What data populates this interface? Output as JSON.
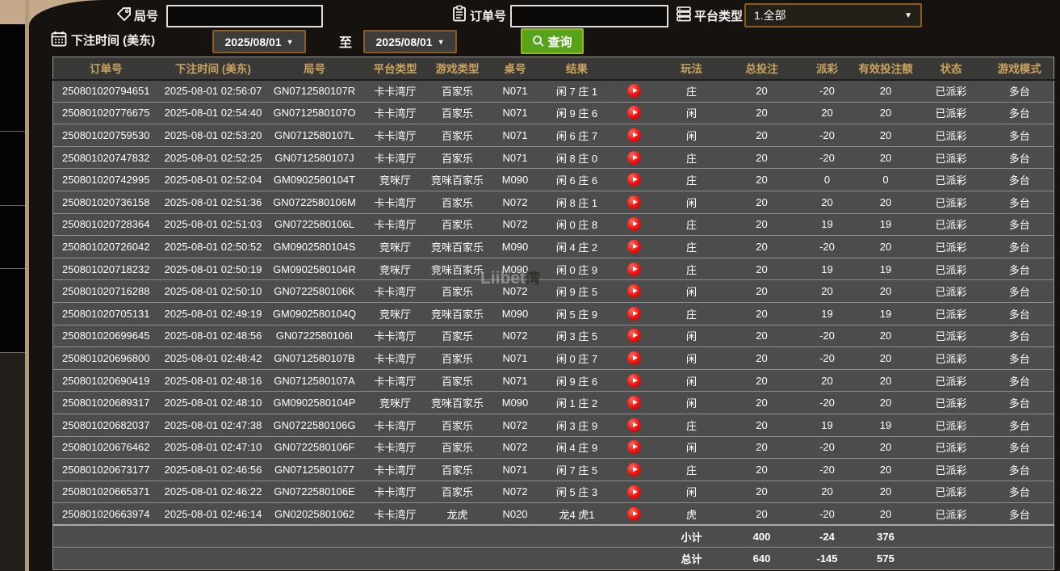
{
  "colors": {
    "win_red": "#c83c3c",
    "loss_green": "#32d232",
    "status_green": "#32d232",
    "total_yellow": "#e8e400",
    "header_gold": "#cba35e",
    "query_green": "#57a41a",
    "field_border_brown": "#8d5b1d"
  },
  "watermark": {
    "text": "Liibet",
    "suffix": "湾"
  },
  "form": {
    "round_label": "局号",
    "round_value": "",
    "order_label": "订单号",
    "order_value": "",
    "platform_label": "平台类型",
    "platform_value": "1.全部",
    "time_label": "下注时间 (美东)",
    "date_from": "2025/08/01",
    "to_label": "至",
    "date_to": "2025/08/01",
    "query_label": "查询",
    "dropdown_arrow": "▼"
  },
  "table": {
    "headers": [
      "订单号",
      "下注时间 (美东)",
      "局号",
      "平台类型",
      "游戏类型",
      "桌号",
      "结果",
      "",
      "玩法",
      "总投注",
      "派彩",
      "有效投注额",
      "状态",
      "游戏模式"
    ],
    "rows": [
      {
        "order": "250801020794651",
        "time": "2025-08-01 02:56:07",
        "round": "GN0712580107R",
        "platform": "卡卡湾厅",
        "game": "百家乐",
        "table_no": "N071",
        "result": "闲 7 庄 1",
        "bet": "庄",
        "total": "20",
        "payout": "-20",
        "payout_color": "green",
        "valid": "20",
        "status": "已派彩",
        "mode": "多台"
      },
      {
        "order": "250801020776675",
        "time": "2025-08-01 02:54:40",
        "round": "GN0712580107O",
        "platform": "卡卡湾厅",
        "game": "百家乐",
        "table_no": "N071",
        "result": "闲 9 庄 6",
        "bet": "闲",
        "total": "20",
        "payout": "20",
        "payout_color": "red",
        "valid": "20",
        "status": "已派彩",
        "mode": "多台"
      },
      {
        "order": "250801020759530",
        "time": "2025-08-01 02:53:20",
        "round": "GN0712580107L",
        "platform": "卡卡湾厅",
        "game": "百家乐",
        "table_no": "N071",
        "result": "闲 6 庄 7",
        "bet": "闲",
        "total": "20",
        "payout": "-20",
        "payout_color": "green",
        "valid": "20",
        "status": "已派彩",
        "mode": "多台"
      },
      {
        "order": "250801020747832",
        "time": "2025-08-01 02:52:25",
        "round": "GN0712580107J",
        "platform": "卡卡湾厅",
        "game": "百家乐",
        "table_no": "N071",
        "result": "闲 8 庄 0",
        "bet": "庄",
        "total": "20",
        "payout": "-20",
        "payout_color": "green",
        "valid": "20",
        "status": "已派彩",
        "mode": "多台"
      },
      {
        "order": "250801020742995",
        "time": "2025-08-01 02:52:04",
        "round": "GM0902580104T",
        "platform": "竞咪厅",
        "game": "竞咪百家乐",
        "table_no": "M090",
        "result": "闲 6 庄 6",
        "bet": "庄",
        "total": "20",
        "payout": "0",
        "payout_color": "white",
        "valid": "0",
        "status": "已派彩",
        "mode": "多台"
      },
      {
        "order": "250801020736158",
        "time": "2025-08-01 02:51:36",
        "round": "GN0722580106M",
        "platform": "卡卡湾厅",
        "game": "百家乐",
        "table_no": "N072",
        "result": "闲 8 庄 1",
        "bet": "闲",
        "total": "20",
        "payout": "20",
        "payout_color": "red",
        "valid": "20",
        "status": "已派彩",
        "mode": "多台"
      },
      {
        "order": "250801020728364",
        "time": "2025-08-01 02:51:03",
        "round": "GN0722580106L",
        "platform": "卡卡湾厅",
        "game": "百家乐",
        "table_no": "N072",
        "result": "闲 0 庄 8",
        "bet": "庄",
        "total": "20",
        "payout": "19",
        "payout_color": "red",
        "valid": "19",
        "status": "已派彩",
        "mode": "多台"
      },
      {
        "order": "250801020726042",
        "time": "2025-08-01 02:50:52",
        "round": "GM0902580104S",
        "platform": "竞咪厅",
        "game": "竞咪百家乐",
        "table_no": "M090",
        "result": "闲 4 庄 2",
        "bet": "庄",
        "total": "20",
        "payout": "-20",
        "payout_color": "green",
        "valid": "20",
        "status": "已派彩",
        "mode": "多台"
      },
      {
        "order": "250801020718232",
        "time": "2025-08-01 02:50:19",
        "round": "GM0902580104R",
        "platform": "竞咪厅",
        "game": "竞咪百家乐",
        "table_no": "M090",
        "result": "闲 0 庄 9",
        "bet": "庄",
        "total": "20",
        "payout": "19",
        "payout_color": "red",
        "valid": "19",
        "status": "已派彩",
        "mode": "多台"
      },
      {
        "order": "250801020716288",
        "time": "2025-08-01 02:50:10",
        "round": "GN0722580106K",
        "platform": "卡卡湾厅",
        "game": "百家乐",
        "table_no": "N072",
        "result": "闲 9 庄 5",
        "bet": "闲",
        "total": "20",
        "payout": "20",
        "payout_color": "red",
        "valid": "20",
        "status": "已派彩",
        "mode": "多台"
      },
      {
        "order": "250801020705131",
        "time": "2025-08-01 02:49:19",
        "round": "GM0902580104Q",
        "platform": "竞咪厅",
        "game": "竞咪百家乐",
        "table_no": "M090",
        "result": "闲 5 庄 9",
        "bet": "庄",
        "total": "20",
        "payout": "19",
        "payout_color": "red",
        "valid": "19",
        "status": "已派彩",
        "mode": "多台"
      },
      {
        "order": "250801020699645",
        "time": "2025-08-01 02:48:56",
        "round": "GN0722580106I",
        "platform": "卡卡湾厅",
        "game": "百家乐",
        "table_no": "N072",
        "result": "闲 3 庄 5",
        "bet": "闲",
        "total": "20",
        "payout": "-20",
        "payout_color": "green",
        "valid": "20",
        "status": "已派彩",
        "mode": "多台"
      },
      {
        "order": "250801020696800",
        "time": "2025-08-01 02:48:42",
        "round": "GN0712580107B",
        "platform": "卡卡湾厅",
        "game": "百家乐",
        "table_no": "N071",
        "result": "闲 0 庄 7",
        "bet": "闲",
        "total": "20",
        "payout": "-20",
        "payout_color": "green",
        "valid": "20",
        "status": "已派彩",
        "mode": "多台"
      },
      {
        "order": "250801020690419",
        "time": "2025-08-01 02:48:16",
        "round": "GN0712580107A",
        "platform": "卡卡湾厅",
        "game": "百家乐",
        "table_no": "N071",
        "result": "闲 9 庄 6",
        "bet": "闲",
        "total": "20",
        "payout": "20",
        "payout_color": "red",
        "valid": "20",
        "status": "已派彩",
        "mode": "多台"
      },
      {
        "order": "250801020689317",
        "time": "2025-08-01 02:48:10",
        "round": "GM0902580104P",
        "platform": "竞咪厅",
        "game": "竞咪百家乐",
        "table_no": "M090",
        "result": "闲 1 庄 2",
        "bet": "闲",
        "total": "20",
        "payout": "-20",
        "payout_color": "green",
        "valid": "20",
        "status": "已派彩",
        "mode": "多台"
      },
      {
        "order": "250801020682037",
        "time": "2025-08-01 02:47:38",
        "round": "GN0722580106G",
        "platform": "卡卡湾厅",
        "game": "百家乐",
        "table_no": "N072",
        "result": "闲 3 庄 9",
        "bet": "庄",
        "total": "20",
        "payout": "19",
        "payout_color": "red",
        "valid": "19",
        "status": "已派彩",
        "mode": "多台"
      },
      {
        "order": "250801020676462",
        "time": "2025-08-01 02:47:10",
        "round": "GN0722580106F",
        "platform": "卡卡湾厅",
        "game": "百家乐",
        "table_no": "N072",
        "result": "闲 4 庄 9",
        "bet": "闲",
        "total": "20",
        "payout": "-20",
        "payout_color": "green",
        "valid": "20",
        "status": "已派彩",
        "mode": "多台"
      },
      {
        "order": "250801020673177",
        "time": "2025-08-01 02:46:56",
        "round": "GN07125801077",
        "platform": "卡卡湾厅",
        "game": "百家乐",
        "table_no": "N071",
        "result": "闲 7 庄 5",
        "bet": "庄",
        "total": "20",
        "payout": "-20",
        "payout_color": "green",
        "valid": "20",
        "status": "已派彩",
        "mode": "多台"
      },
      {
        "order": "250801020665371",
        "time": "2025-08-01 02:46:22",
        "round": "GN0722580106E",
        "platform": "卡卡湾厅",
        "game": "百家乐",
        "table_no": "N072",
        "result": "闲 5 庄 3",
        "bet": "闲",
        "total": "20",
        "payout": "20",
        "payout_color": "red",
        "valid": "20",
        "status": "已派彩",
        "mode": "多台"
      },
      {
        "order": "250801020663974",
        "time": "2025-08-01 02:46:14",
        "round": "GN02025801062",
        "platform": "卡卡湾厅",
        "game": "龙虎",
        "table_no": "N020",
        "result": "龙4 虎1",
        "bet": "虎",
        "total": "20",
        "payout": "-20",
        "payout_color": "green",
        "valid": "20",
        "status": "已派彩",
        "mode": "多台"
      }
    ],
    "totals": [
      {
        "label": "小计",
        "total": "400",
        "payout": "-24",
        "valid": "376"
      },
      {
        "label": "总计",
        "total": "640",
        "payout": "-145",
        "valid": "575"
      }
    ]
  }
}
